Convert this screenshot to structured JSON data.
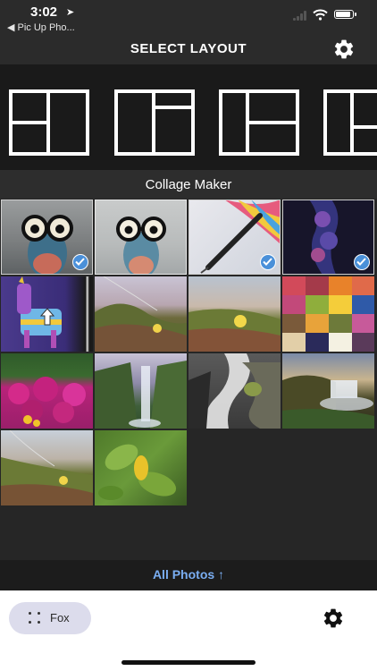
{
  "status_bar": {
    "time": "3:02",
    "back_app": "◀ Pic Up Pho..."
  },
  "header": {
    "title": "SELECT LAYOUT",
    "settings_icon": "gear-icon"
  },
  "layouts": [
    {
      "name": "layout-left-split-right-full"
    },
    {
      "name": "layout-top-strip-two-columns"
    },
    {
      "name": "layout-left-full-right-split"
    },
    {
      "name": "layout-left-full-right-split-partial"
    }
  ],
  "section": {
    "title": "Collage Maker"
  },
  "photos": [
    {
      "subject": "frog-glasses",
      "selected": true
    },
    {
      "subject": "frog-glasses-light",
      "selected": false,
      "highlighted": true
    },
    {
      "subject": "pen-rainbow",
      "selected": true
    },
    {
      "subject": "purple-dots",
      "selected": true
    },
    {
      "subject": "llama-pinata",
      "selected": false
    },
    {
      "subject": "meadow-hill",
      "selected": false
    },
    {
      "subject": "meadow-flowers",
      "selected": false
    },
    {
      "subject": "color-grid",
      "selected": false
    },
    {
      "subject": "pink-flowers",
      "selected": false
    },
    {
      "subject": "waterfall-valley",
      "selected": false
    },
    {
      "subject": "waterfall-rocks",
      "selected": false
    },
    {
      "subject": "waterfall-sunset",
      "selected": false
    },
    {
      "subject": "hillside-grass",
      "selected": false
    },
    {
      "subject": "green-leaves",
      "selected": false
    }
  ],
  "all_photos": {
    "label": "All Photos ↑"
  },
  "bottom_bar": {
    "fox_label": "Fox",
    "settings_icon": "gear-icon"
  },
  "colors": {
    "accent_link": "#7aaef2",
    "check_blue": "#4a90d9",
    "dark_bg": "#262626"
  }
}
